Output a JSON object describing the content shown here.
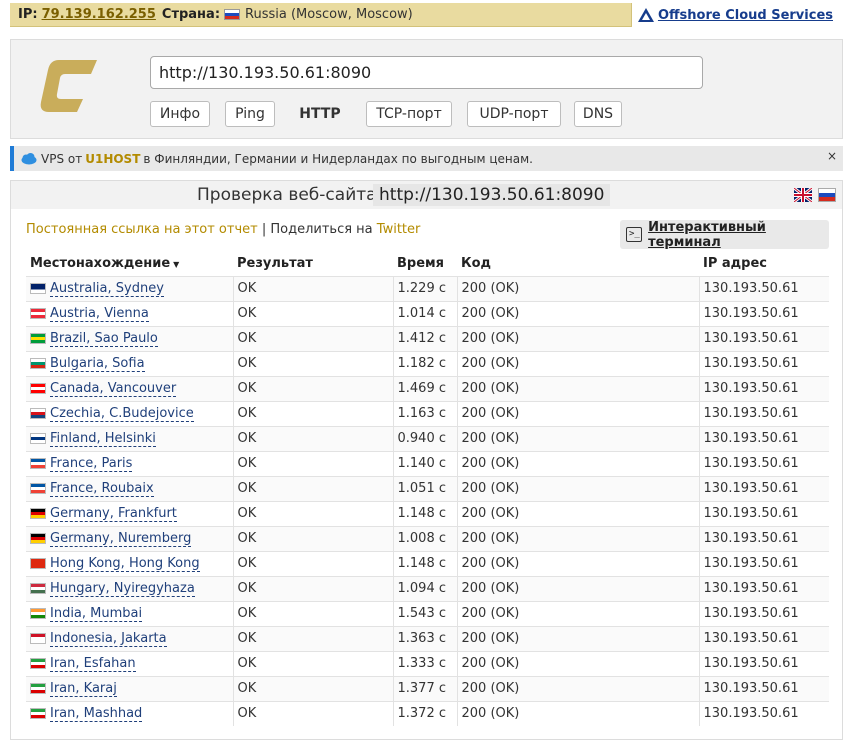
{
  "topbar": {
    "ip_label": "IP:",
    "ip_value": "79.139.162.255",
    "country_label": "Страна:",
    "country_value": "Russia (Moscow, Moscow)",
    "offshore_link": "Offshore Cloud Services"
  },
  "header": {
    "url_value": "http://130.193.50.61:8090",
    "buttons": [
      "Инфо",
      "Ping",
      "HTTP",
      "TCP-порт",
      "UDP-порт",
      "DNS"
    ],
    "active_button": "HTTP"
  },
  "ad": {
    "prefix": "VPS от",
    "brand": "U1HOST",
    "suffix": "в Финляндии, Германии и Нидерландах по выгодным ценам.",
    "close": "×"
  },
  "check": {
    "title": "Проверка веб-сайта",
    "url": "http://130.193.50.61:8090",
    "permalink": "Постоянная ссылка на этот отчет",
    "separator": "|",
    "share_prefix": "Поделиться на",
    "share_target": "Twitter",
    "terminal_button": "Интерактивный терминал"
  },
  "table": {
    "headers": [
      "Местонахождение",
      "Результат",
      "Время",
      "Код",
      "IP адрес"
    ],
    "rows": [
      {
        "flag": [
          "#012169",
          "#ffffff"
        ],
        "location": "Australia, Sydney",
        "result": "OK",
        "time": "1.229 с",
        "code": "200 (OK)",
        "ip": "130.193.50.61"
      },
      {
        "flag": [
          "#ed2939",
          "#ffffff",
          "#ed2939"
        ],
        "location": "Austria, Vienna",
        "result": "OK",
        "time": "1.014 с",
        "code": "200 (OK)",
        "ip": "130.193.50.61"
      },
      {
        "flag": [
          "#009c3b",
          "#ffdf00",
          "#009c3b"
        ],
        "location": "Brazil, Sao Paulo",
        "result": "OK",
        "time": "1.412 с",
        "code": "200 (OK)",
        "ip": "130.193.50.61"
      },
      {
        "flag": [
          "#ffffff",
          "#00966e",
          "#d62612"
        ],
        "location": "Bulgaria, Sofia",
        "result": "OK",
        "time": "1.182 с",
        "code": "200 (OK)",
        "ip": "130.193.50.61"
      },
      {
        "flag": [
          "#ff0000",
          "#ffffff",
          "#ff0000"
        ],
        "location": "Canada, Vancouver",
        "result": "OK",
        "time": "1.469 с",
        "code": "200 (OK)",
        "ip": "130.193.50.61"
      },
      {
        "flag": [
          "#ffffff",
          "#d7141a",
          "#11457e"
        ],
        "location": "Czechia, C.Budejovice",
        "result": "OK",
        "time": "1.163 с",
        "code": "200 (OK)",
        "ip": "130.193.50.61"
      },
      {
        "flag": [
          "#ffffff",
          "#003580",
          "#ffffff"
        ],
        "location": "Finland, Helsinki",
        "result": "OK",
        "time": "0.940 с",
        "code": "200 (OK)",
        "ip": "130.193.50.61"
      },
      {
        "flag": [
          "#0055a4",
          "#ffffff",
          "#ef4135"
        ],
        "location": "France, Paris",
        "result": "OK",
        "time": "1.140 с",
        "code": "200 (OK)",
        "ip": "130.193.50.61"
      },
      {
        "flag": [
          "#0055a4",
          "#ffffff",
          "#ef4135"
        ],
        "location": "France, Roubaix",
        "result": "OK",
        "time": "1.051 с",
        "code": "200 (OK)",
        "ip": "130.193.50.61"
      },
      {
        "flag": [
          "#000000",
          "#dd0000",
          "#ffce00"
        ],
        "location": "Germany, Frankfurt",
        "result": "OK",
        "time": "1.148 с",
        "code": "200 (OK)",
        "ip": "130.193.50.61"
      },
      {
        "flag": [
          "#000000",
          "#dd0000",
          "#ffce00"
        ],
        "location": "Germany, Nuremberg",
        "result": "OK",
        "time": "1.008 с",
        "code": "200 (OK)",
        "ip": "130.193.50.61"
      },
      {
        "flag": [
          "#de2910",
          "#de2910",
          "#de2910"
        ],
        "location": "Hong Kong, Hong Kong",
        "result": "OK",
        "time": "1.148 с",
        "code": "200 (OK)",
        "ip": "130.193.50.61"
      },
      {
        "flag": [
          "#cd2a3e",
          "#ffffff",
          "#436f4d"
        ],
        "location": "Hungary, Nyiregyhaza",
        "result": "OK",
        "time": "1.094 с",
        "code": "200 (OK)",
        "ip": "130.193.50.61"
      },
      {
        "flag": [
          "#ff9933",
          "#ffffff",
          "#138808"
        ],
        "location": "India, Mumbai",
        "result": "OK",
        "time": "1.543 с",
        "code": "200 (OK)",
        "ip": "130.193.50.61"
      },
      {
        "flag": [
          "#ce1126",
          "#ffffff",
          "#ffffff"
        ],
        "location": "Indonesia, Jakarta",
        "result": "OK",
        "time": "1.363 с",
        "code": "200 (OK)",
        "ip": "130.193.50.61"
      },
      {
        "flag": [
          "#239f40",
          "#ffffff",
          "#da0000"
        ],
        "location": "Iran, Esfahan",
        "result": "OK",
        "time": "1.333 с",
        "code": "200 (OK)",
        "ip": "130.193.50.61"
      },
      {
        "flag": [
          "#239f40",
          "#ffffff",
          "#da0000"
        ],
        "location": "Iran, Karaj",
        "result": "OK",
        "time": "1.377 с",
        "code": "200 (OK)",
        "ip": "130.193.50.61"
      },
      {
        "flag": [
          "#239f40",
          "#ffffff",
          "#da0000"
        ],
        "location": "Iran, Mashhad",
        "result": "OK",
        "time": "1.372 с",
        "code": "200 (OK)",
        "ip": "130.193.50.61"
      }
    ]
  }
}
